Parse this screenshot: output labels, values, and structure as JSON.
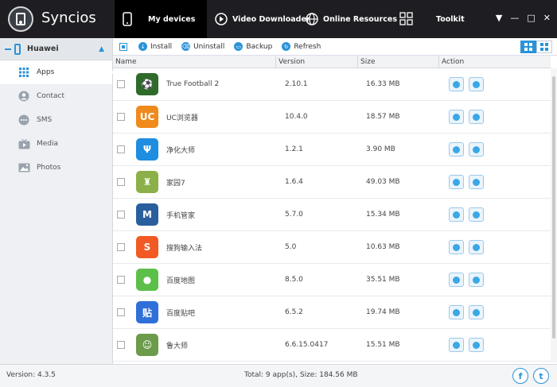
{
  "app": {
    "title": "Syncios",
    "version_text": "Version: 4.3.5"
  },
  "nav": {
    "my_devices": "My devices",
    "video_downloader": "Video Downloader",
    "online_resources": "Online Resources",
    "toolkit": "Toolkit"
  },
  "window_controls": {
    "menu": "▼",
    "minimize": "—",
    "maximize": "□",
    "close": "✕"
  },
  "device": {
    "name": "Huawei"
  },
  "sidebar": {
    "items": [
      {
        "label": "Apps",
        "icon": "apps-grid-icon"
      },
      {
        "label": "Contact",
        "icon": "contact-icon"
      },
      {
        "label": "SMS",
        "icon": "sms-icon"
      },
      {
        "label": "Media",
        "icon": "media-tv-icon"
      },
      {
        "label": "Photos",
        "icon": "photos-icon"
      }
    ]
  },
  "toolbar": {
    "install": "Install",
    "uninstall": "Uninstall",
    "backup": "Backup",
    "refresh": "Refresh"
  },
  "table": {
    "headers": {
      "name": "Name",
      "version": "Version",
      "size": "Size",
      "action": "Action"
    },
    "rows": [
      {
        "name": "True Football 2",
        "version": "2.10.1",
        "size": "16.33 MB",
        "icon_color": "#2e6b2a",
        "glyph": "⚽"
      },
      {
        "name": "UC浏览器",
        "version": "10.4.0",
        "size": "18.57 MB",
        "icon_color": "#f08a1c",
        "glyph": "UC"
      },
      {
        "name": "净化大师",
        "version": "1.2.1",
        "size": "3.90 MB",
        "icon_color": "#1f8de0",
        "glyph": "Ψ"
      },
      {
        "name": "家园7",
        "version": "1.6.4",
        "size": "49.03 MB",
        "icon_color": "#8bb04a",
        "glyph": "♜"
      },
      {
        "name": "手机管家",
        "version": "5.7.0",
        "size": "15.34 MB",
        "icon_color": "#2a5f9e",
        "glyph": "M"
      },
      {
        "name": "搜狗输入法",
        "version": "5.0",
        "size": "10.63 MB",
        "icon_color": "#f15a24",
        "glyph": "S"
      },
      {
        "name": "百度地图",
        "version": "8.5.0",
        "size": "35.51 MB",
        "icon_color": "#5cbf4a",
        "glyph": "●"
      },
      {
        "name": "百度贴吧",
        "version": "6.5.2",
        "size": "19.74 MB",
        "icon_color": "#2f6fd8",
        "glyph": "贴"
      },
      {
        "name": "鲁大师",
        "version": "6.6.15.0417",
        "size": "15.51 MB",
        "icon_color": "#6b9b4b",
        "glyph": "☺"
      }
    ]
  },
  "footer": {
    "total_text": "Total: 9 app(s), Size: 184.56 MB",
    "facebook": "f",
    "twitter": "t"
  },
  "colors": {
    "accent": "#2b93d8",
    "topbar": "#1e1e22"
  }
}
